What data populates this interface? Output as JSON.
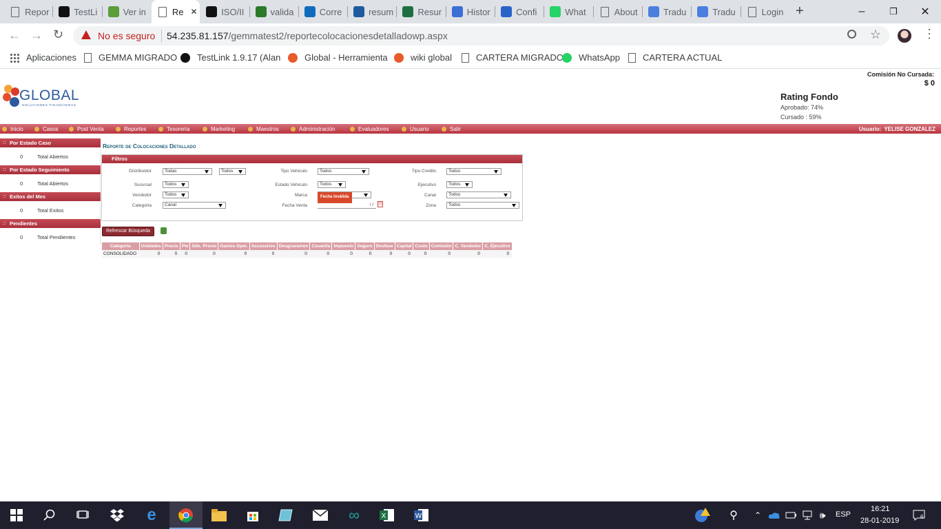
{
  "browser": {
    "tabs": [
      {
        "label": "Repor",
        "icon": "page-icon"
      },
      {
        "label": "TestLi",
        "icon": "testlink-icon"
      },
      {
        "label": "Ver in",
        "icon": "bug-icon"
      },
      {
        "label": "Re",
        "icon": "page-icon",
        "active": true
      },
      {
        "label": "ISO/II",
        "icon": "wikipedia-icon"
      },
      {
        "label": "valida",
        "icon": "checkbox-icon"
      },
      {
        "label": "Corre",
        "icon": "outlook-icon"
      },
      {
        "label": "resum",
        "icon": "cloud-icon"
      },
      {
        "label": "Resur",
        "icon": "excel-icon"
      },
      {
        "label": "Histor",
        "icon": "history-icon"
      },
      {
        "label": "Confi",
        "icon": "gear-icon"
      },
      {
        "label": "What",
        "icon": "whatsapp-icon"
      },
      {
        "label": "About",
        "icon": "page-icon"
      },
      {
        "label": "Tradu",
        "icon": "translate-icon"
      },
      {
        "label": "Tradu",
        "icon": "translate-icon"
      },
      {
        "label": "Login",
        "icon": "page-icon"
      }
    ],
    "new_tab": "+",
    "window_controls": {
      "minimize": "–",
      "restore": "❐",
      "close": "✕"
    },
    "address": {
      "security_label": "No es seguro",
      "host": "54.235.81.157",
      "path": "/gemmatest2/reportecolocacionesdetalladowp.aspx"
    },
    "bookmarks": [
      {
        "label": "Aplicaciones",
        "icon": "apps-icon"
      },
      {
        "label": "GEMMA MIGRADO",
        "icon": "page-icon"
      },
      {
        "label": "TestLink 1.9.17 (Alan",
        "icon": "testlink-icon"
      },
      {
        "label": "Global - Herramienta",
        "icon": "global-icon"
      },
      {
        "label": "wiki global",
        "icon": "global-icon"
      },
      {
        "label": "CARTERA MIGRADO",
        "icon": "page-icon"
      },
      {
        "label": "WhatsApp",
        "icon": "whatsapp-icon"
      },
      {
        "label": "CARTERA ACTUAL",
        "icon": "page-icon"
      }
    ]
  },
  "header": {
    "logo_text": "GLOBAL",
    "logo_sub": "SOLUCIONES FINANCIERAS",
    "comision_label": "Comisión No Cursada:",
    "comision_value": "$ 0",
    "rating_title": "Rating Fondo",
    "aprobado": "Aprobado: 74%",
    "cursado": "Cursado : 59%"
  },
  "menu": {
    "items": [
      "Inicio",
      "Casos",
      "Post Venta",
      "Reportes",
      "Tesorería",
      "Marketing",
      "Maestros",
      "Administración",
      "Evaluadores",
      "Usuario",
      "Salir"
    ],
    "user_label": "Usuario:",
    "user_name": "YELISE GONZALEZ"
  },
  "sidebar": [
    {
      "header": "Por Estado Caso",
      "count": "0",
      "label": "Total Abiertos"
    },
    {
      "header": "Por Estado Seguimiento",
      "count": "0",
      "label": "Total Abiertos"
    },
    {
      "header": "Exitos del Mes",
      "count": "0",
      "label": "Total Exitos"
    },
    {
      "header": "Pendientes",
      "count": "0",
      "label": "Total Pendientes"
    }
  ],
  "report": {
    "title": "Reporte de Colocaciones Detallado",
    "filters_title": "Filtros",
    "filters": {
      "distribuidor_label": "Distribuidor",
      "distribuidor_value": "Todas",
      "distribuidor_value2": "Todos",
      "sucursal_label": "Sucursal",
      "sucursal_value": "Todos",
      "vendedor_label": "Vendedor",
      "vendedor_value": "Todos",
      "categoria_label": "Categoria",
      "categoria_value": "Canal",
      "tipo_vehiculo_label": "Tipo Vehiculo",
      "tipo_vehiculo_value": "Todos",
      "estado_vehiculo_label": "Estado Vehiculo",
      "estado_vehiculo_value": "Todos",
      "marca_label": "Marca",
      "fecha_venta_label": "Fecha Venta",
      "fecha_venta_value": "/ /",
      "fecha_error": "Fecha inválida",
      "tipo_credito_label": "Tipo Credito",
      "tipo_credito_value": "Todos",
      "ejecutivo_label": "Ejecutivo",
      "ejecutivo_value": "Todos",
      "canal_label": "Canal",
      "canal_value": "Todos",
      "zona_label": "Zona",
      "zona_value": "Todos"
    },
    "refresh_button": "Refrescar Búsqueda",
    "table": {
      "headers": [
        "Categoria",
        "Unidades",
        "Precio",
        "Pie",
        "Sdo. Precio",
        "Gastos Oper.",
        "Accesorios",
        "Desgravamen",
        "Cesantia",
        "Impuesto",
        "Seguro",
        "Desfase",
        "Capital",
        "Costo",
        "Comisión",
        "C. Vendedor",
        "C. Ejecutivo"
      ],
      "rows": [
        [
          "CONSOLIDADO",
          "0",
          "0",
          "0",
          "0",
          "0",
          "0",
          "0",
          "0",
          "0",
          "0",
          "0",
          "0",
          "0",
          "0",
          "0",
          "0"
        ]
      ]
    }
  },
  "taskbar": {
    "lang": "ESP",
    "time": "16:21",
    "date": "28-01-2019",
    "notifications": "6"
  },
  "colors": {
    "accent": "#b9343f",
    "table_header": "#d99ea3",
    "title_text": "#1f5f7a"
  }
}
